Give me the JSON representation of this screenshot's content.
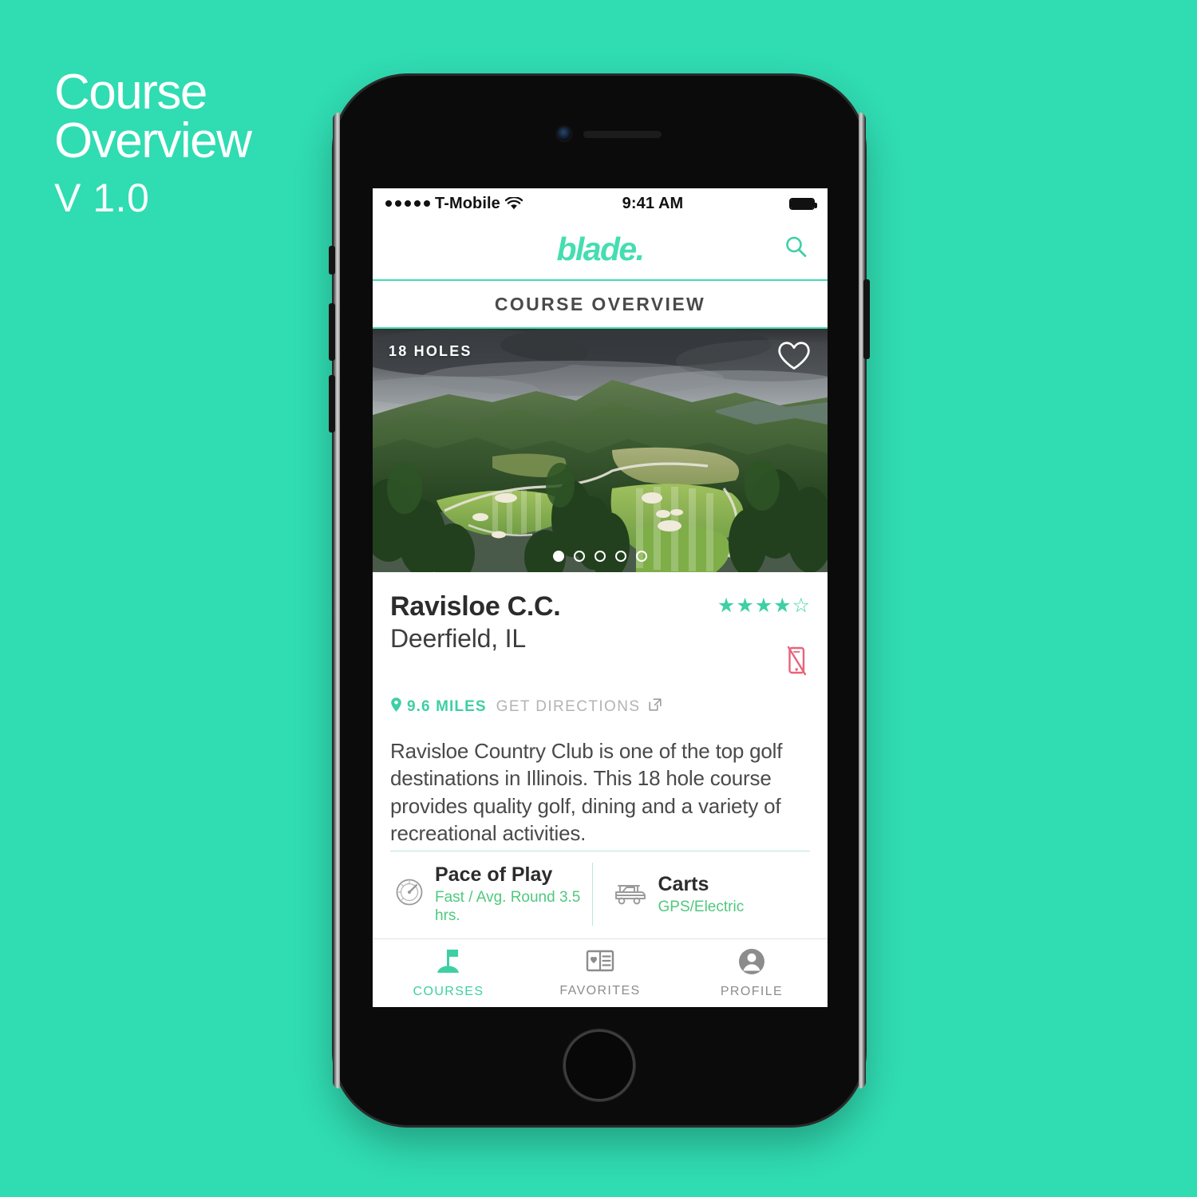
{
  "promo": {
    "title_line1": "Course",
    "title_line2": "Overview",
    "version": "V 1.0"
  },
  "colors": {
    "background": "#30DCB2",
    "mint": "#3ECFA4",
    "logo_mint": "#45DDB1",
    "green_text": "#4FC97E",
    "red": "#E8637A",
    "gray_text": "#8C8C8C"
  },
  "statusbar": {
    "carrier": "T-Mobile",
    "time": "9:41 AM",
    "signal_dots": 5,
    "wifi_icon": "wifi-icon",
    "battery_icon": "battery-full-icon"
  },
  "appbar": {
    "logo": "blade.",
    "search_icon": "search-icon"
  },
  "section": {
    "title": "COURSE OVERVIEW"
  },
  "hero": {
    "badge": "18 HOLES",
    "favorite_icon": "heart-outline-icon",
    "carousel_total": 5,
    "carousel_active": 1
  },
  "course": {
    "name": "Ravisloe C.C.",
    "location": "Deerfield, IL",
    "rating_filled": 4,
    "rating_total": 5,
    "distance": "9.6 MILES",
    "directions_label": "GET DIRECTIONS",
    "directions_icon": "external-link-icon",
    "pin_icon": "map-pin-icon",
    "no_phone_icon": "no-phone-icon",
    "description": "Ravisloe Country Club is one of the top golf destinations in Illinois. This 18 hole course provides quality golf, dining and a variety of recreational activities."
  },
  "stats": [
    {
      "icon": "speedometer-icon",
      "label": "Pace of Play",
      "value": "Fast / Avg. Round 3.5 hrs."
    },
    {
      "icon": "golf-cart-icon",
      "label": "Carts",
      "value": "GPS/Electric"
    }
  ],
  "tabbar": [
    {
      "icon": "golf-flag-icon",
      "label": "COURSES",
      "active": true
    },
    {
      "icon": "favorites-card-icon",
      "label": "FAVORITES",
      "active": false
    },
    {
      "icon": "profile-person-icon",
      "label": "PROFILE",
      "active": false
    }
  ]
}
